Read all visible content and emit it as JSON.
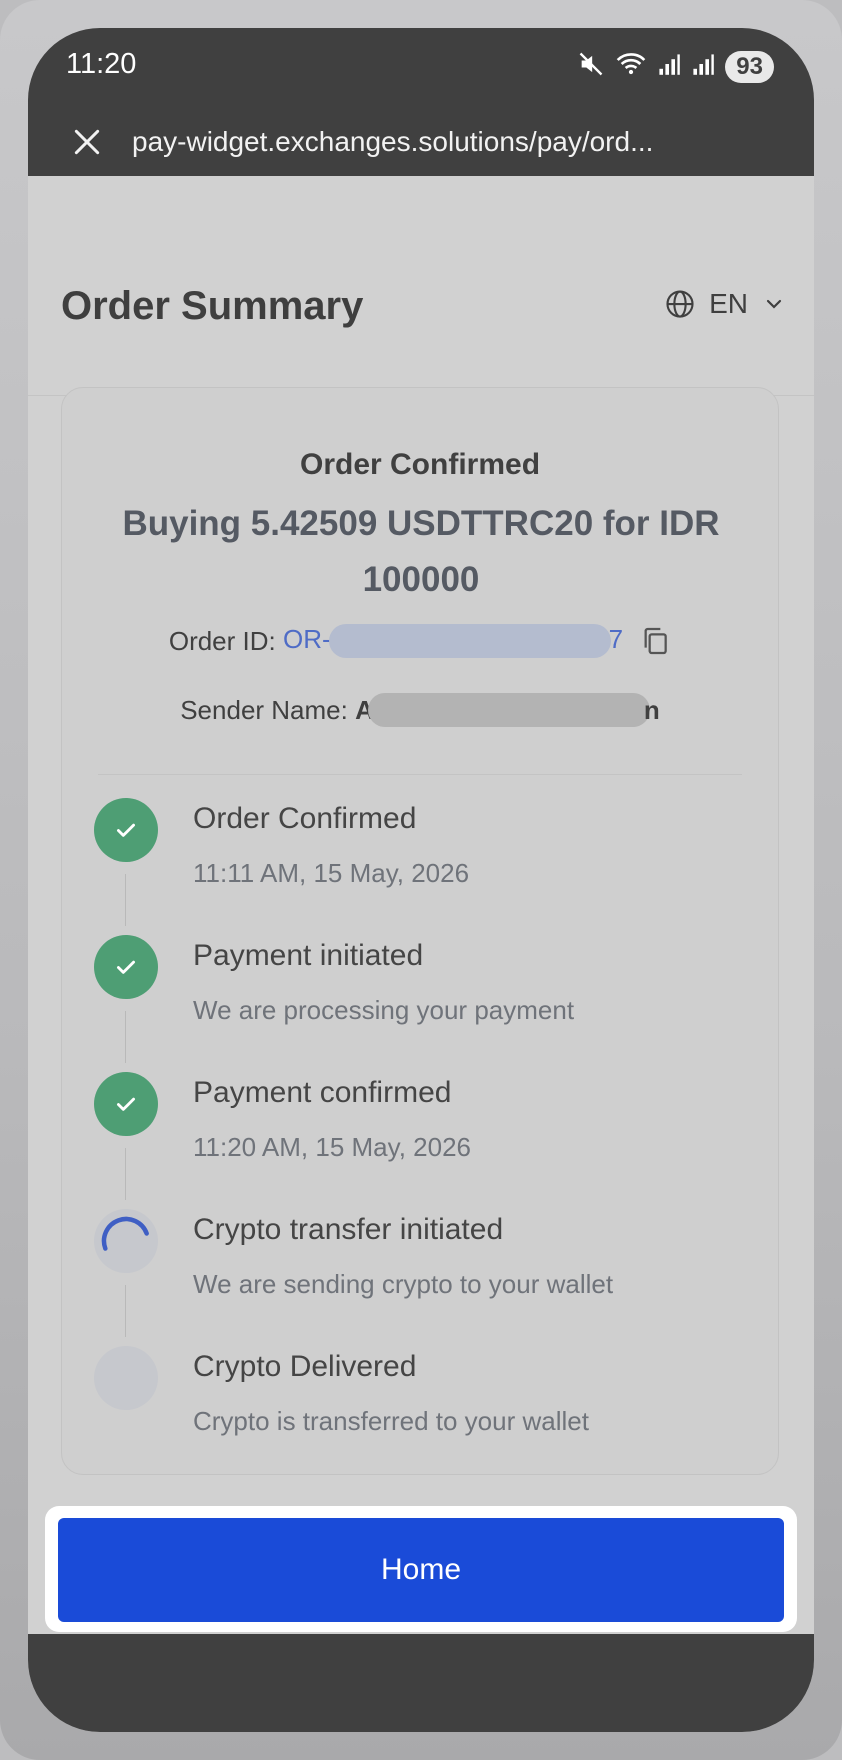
{
  "status_bar": {
    "time": "11:20",
    "battery": "93"
  },
  "browser": {
    "url": "pay-widget.exchanges.solutions/pay/ord..."
  },
  "header": {
    "title": "Order Summary",
    "language": "EN"
  },
  "order": {
    "status_title": "Order Confirmed",
    "summary": "Buying 5.42509 USDTTRC20 for IDR 100000",
    "order_id_label": "Order ID:",
    "order_id_prefix": "OR-",
    "order_id_suffix": "7",
    "sender_label": "Sender Name:",
    "sender_prefix": "A",
    "sender_suffix": "n"
  },
  "timeline": [
    {
      "title": "Order Confirmed",
      "subtitle": "11:11 AM, 15 May, 2026",
      "state": "done"
    },
    {
      "title": "Payment initiated",
      "subtitle": "We are processing your payment",
      "state": "done"
    },
    {
      "title": "Payment confirmed",
      "subtitle": "11:20 AM, 15 May, 2026",
      "state": "done"
    },
    {
      "title": "Crypto transfer initiated",
      "subtitle": "We are sending crypto to your wallet",
      "state": "in-progress"
    },
    {
      "title": "Crypto Delivered",
      "subtitle": "Crypto is transferred to your wallet",
      "state": "pending"
    }
  ],
  "actions": {
    "home_label": "Home"
  },
  "colors": {
    "done": "#4e9e74",
    "accent": "#1a4bd8",
    "link": "#4f6cc6"
  }
}
